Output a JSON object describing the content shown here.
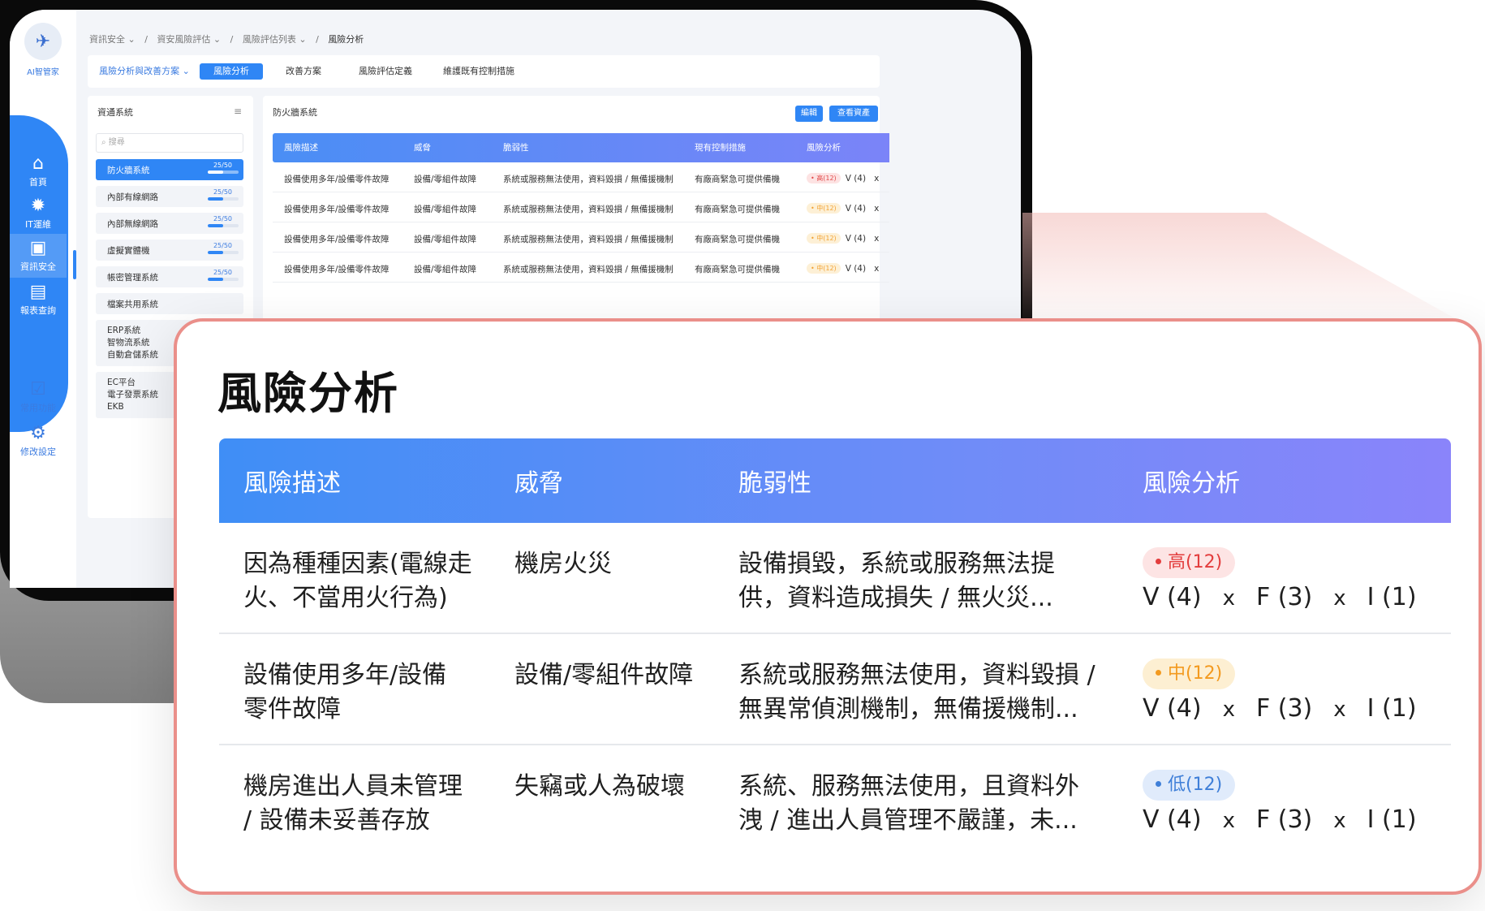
{
  "sidebar": {
    "logo_text": "AI智管家",
    "items": [
      {
        "label": "首頁",
        "icon": "home-icon",
        "glyph": "⌂"
      },
      {
        "label": "IT運維",
        "icon": "chip-icon",
        "glyph": "✹"
      },
      {
        "label": "資訊安全",
        "icon": "monitor-shield-icon",
        "glyph": "▣"
      },
      {
        "label": "報表查詢",
        "icon": "report-icon",
        "glyph": "▤"
      }
    ],
    "bottom_items": [
      {
        "label": "常用功能",
        "icon": "checklist-icon",
        "glyph": "☑"
      },
      {
        "label": "修改設定",
        "icon": "gear-icon",
        "glyph": "⚙"
      }
    ]
  },
  "breadcrumb": [
    "資訊安全 ⌄",
    "/",
    "資安風險評估 ⌄",
    "/",
    "風險評估列表 ⌄",
    "/",
    "風險分析"
  ],
  "tabs": {
    "dropdown": "風險分析與改善方案 ⌄",
    "items": [
      "風險分析",
      "改善方案",
      "風險評估定義",
      "維護既有控制措施"
    ]
  },
  "system_panel": {
    "title": "資通系統",
    "menu_icon": "≡",
    "search_placeholder": "⌕ 搜尋",
    "items": [
      {
        "name": "防火牆系統",
        "count": "25/50",
        "progress": 0.5
      },
      {
        "name": "內部有線網路",
        "count": "25/50",
        "progress": 0.5
      },
      {
        "name": "內部無線網路",
        "count": "25/50",
        "progress": 0.5
      },
      {
        "name": "虛擬實體機",
        "count": "25/50",
        "progress": 0.5
      },
      {
        "name": "帳密管理系統",
        "count": "25/50",
        "progress": 0.5
      },
      {
        "name": "檔案共用系統",
        "count": "",
        "progress": 0
      }
    ],
    "group1": [
      "ERP系統",
      "智物流系統",
      "自動倉儲系統"
    ],
    "group2": [
      "EC平台",
      "電子發票系統",
      "EKB"
    ]
  },
  "main_panel": {
    "title": "防火牆系統",
    "edit_button": "編輯",
    "view_button": "查看資產",
    "headers": [
      "風險描述",
      "威脅",
      "脆弱性",
      "現有控制措施",
      "風險分析"
    ],
    "rows": [
      {
        "desc": "設備使用多年/設備零件故障",
        "threat": "設備/零組件故障",
        "vuln": "系統或服務無法使用，資料毀損 / 無備援機制",
        "control": "有廠商緊急可提供備機",
        "badge": "• 高(12)",
        "level": "high",
        "v": "V (4)",
        "x": "x"
      },
      {
        "desc": "設備使用多年/設備零件故障",
        "threat": "設備/零組件故障",
        "vuln": "系統或服務無法使用，資料毀損 / 無備援機制",
        "control": "有廠商緊急可提供備機",
        "badge": "• 中(12)",
        "level": "mid",
        "v": "V (4)",
        "x": "x"
      },
      {
        "desc": "設備使用多年/設備零件故障",
        "threat": "設備/零組件故障",
        "vuln": "系統或服務無法使用，資料毀損 / 無備援機制",
        "control": "有廠商緊急可提供備機",
        "badge": "• 中(12)",
        "level": "mid",
        "v": "V (4)",
        "x": "x"
      },
      {
        "desc": "設備使用多年/設備零件故障",
        "threat": "設備/零組件故障",
        "vuln": "系統或服務無法使用，資料毀損 / 無備援機制",
        "control": "有廠商緊急可提供備機",
        "badge": "• 中(12)",
        "level": "mid",
        "v": "V (4)",
        "x": "x"
      }
    ]
  },
  "callout": {
    "title": "風險分析",
    "headers": [
      "風險描述",
      "威脅",
      "脆弱性",
      "風險分析"
    ],
    "rows": [
      {
        "desc_lines": [
          "因為種種因素(電線走",
          "火、不當用火行為)"
        ],
        "threat": "機房火災",
        "vuln_lines": [
          "設備損毀，系統或服務無法提",
          "供，資料造成損失 / 無火災..."
        ],
        "badge": "高(12)",
        "level": "high",
        "v": "V (4)",
        "f": "F (3)",
        "i": "I (1)",
        "op": "x"
      },
      {
        "desc_lines": [
          "設備使用多年/設備",
          "零件故障"
        ],
        "threat": "設備/零組件故障",
        "vuln_lines": [
          "系統或服務無法使用，資料毀損 /",
          "無異常偵測機制，無備援機制..."
        ],
        "badge": "中(12)",
        "level": "mid",
        "v": "V (4)",
        "f": "F (3)",
        "i": "I (1)",
        "op": "x"
      },
      {
        "desc_lines": [
          "機房進出人員未管理",
          "/ 設備未妥善存放"
        ],
        "threat": "失竊或人為破壞",
        "vuln_lines": [
          "系統、服務無法使用，且資料外",
          "洩 / 進出人員管理不嚴謹，未..."
        ],
        "badge": "低(12)",
        "level": "low",
        "v": "V (4)",
        "f": "F (3)",
        "i": "I (1)",
        "op": "x"
      }
    ]
  },
  "colors": {
    "primary": "#2f86f5",
    "gradient_start": "#3f8ef6",
    "gradient_end": "#8a84fa",
    "callout_border": "#ea8f8a",
    "high": "#e33d3d",
    "mid": "#f39a1f",
    "low": "#3f7fd8"
  }
}
